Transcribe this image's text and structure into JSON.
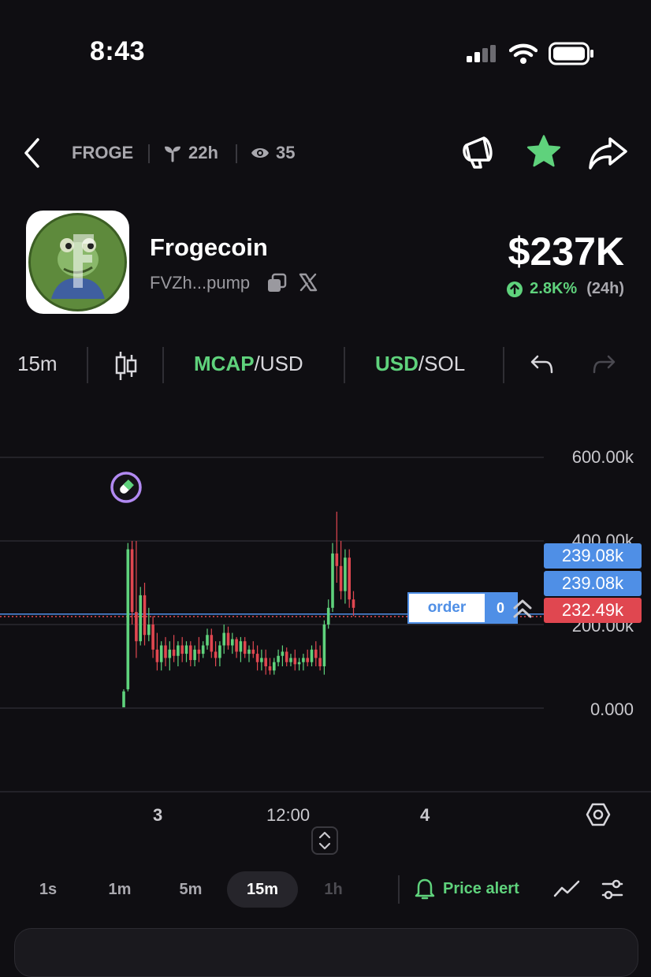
{
  "status_bar": {
    "time": "8:43"
  },
  "header": {
    "ticker": "FROGE",
    "age": "22h",
    "watchers": "35"
  },
  "token": {
    "name": "Frogecoin",
    "address": "FVZh...pump",
    "market_cap": "$237K",
    "change_pct": "2.8K%",
    "change_period": "(24h)"
  },
  "toolbar": {
    "interval": "15m",
    "mcap_highlight": "MCAP",
    "mcap_suffix": "/USD",
    "usd_highlight": "USD",
    "usd_suffix": "/SOL"
  },
  "chart_data": {
    "type": "candlestick",
    "y_ticks": [
      "600.00k",
      "400.00k",
      "200.00k",
      "0.000"
    ],
    "ylim": [
      0,
      600000
    ],
    "x_ticks": [
      "3",
      "12:00",
      "4"
    ],
    "price_labels": [
      "239.08k",
      "239.08k",
      "232.49k"
    ],
    "order_label": "order",
    "order_count": "0",
    "candles": [
      [
        2,
        45,
        2,
        40
      ],
      [
        45,
        395,
        40,
        380
      ],
      [
        380,
        400,
        200,
        230
      ],
      [
        230,
        400,
        120,
        160
      ],
      [
        160,
        290,
        150,
        270
      ],
      [
        270,
        300,
        150,
        175
      ],
      [
        175,
        240,
        160,
        200
      ],
      [
        200,
        220,
        120,
        140
      ],
      [
        140,
        180,
        90,
        110
      ],
      [
        110,
        160,
        90,
        150
      ],
      [
        150,
        170,
        100,
        120
      ],
      [
        120,
        160,
        90,
        140
      ],
      [
        140,
        175,
        110,
        125
      ],
      [
        125,
        160,
        100,
        150
      ],
      [
        150,
        170,
        110,
        130
      ],
      [
        130,
        160,
        110,
        150
      ],
      [
        150,
        160,
        100,
        115
      ],
      [
        115,
        150,
        100,
        140
      ],
      [
        140,
        170,
        110,
        130
      ],
      [
        130,
        160,
        120,
        150
      ],
      [
        150,
        190,
        140,
        175
      ],
      [
        175,
        190,
        120,
        135
      ],
      [
        135,
        160,
        100,
        120
      ],
      [
        120,
        160,
        100,
        150
      ],
      [
        150,
        200,
        130,
        180
      ],
      [
        180,
        195,
        140,
        150
      ],
      [
        150,
        180,
        130,
        165
      ],
      [
        165,
        170,
        120,
        135
      ],
      [
        135,
        170,
        110,
        160
      ],
      [
        160,
        170,
        120,
        130
      ],
      [
        130,
        150,
        110,
        140
      ],
      [
        140,
        160,
        120,
        130
      ],
      [
        130,
        150,
        90,
        110
      ],
      [
        110,
        140,
        90,
        120
      ],
      [
        120,
        140,
        80,
        100
      ],
      [
        100,
        120,
        80,
        90
      ],
      [
        90,
        120,
        80,
        110
      ],
      [
        110,
        140,
        100,
        125
      ],
      [
        125,
        150,
        100,
        135
      ],
      [
        135,
        145,
        100,
        110
      ],
      [
        110,
        130,
        100,
        120
      ],
      [
        120,
        140,
        90,
        105
      ],
      [
        105,
        120,
        90,
        110
      ],
      [
        110,
        130,
        90,
        120
      ],
      [
        120,
        140,
        100,
        110
      ],
      [
        110,
        150,
        100,
        140
      ],
      [
        140,
        160,
        100,
        120
      ],
      [
        120,
        150,
        90,
        100
      ],
      [
        100,
        210,
        80,
        200
      ],
      [
        200,
        260,
        190,
        240
      ],
      [
        240,
        395,
        230,
        370
      ],
      [
        370,
        470,
        300,
        340
      ],
      [
        340,
        400,
        260,
        280
      ],
      [
        280,
        380,
        250,
        360
      ],
      [
        360,
        380,
        240,
        260
      ],
      [
        260,
        280,
        220,
        240
      ]
    ]
  },
  "bottom_bar": {
    "timeframes": [
      "1s",
      "1m",
      "5m",
      "15m",
      "1h"
    ],
    "selected_timeframe": "15m",
    "price_alert_label": "Price alert"
  },
  "colors": {
    "up": "#5fd27c",
    "down": "#e04750",
    "accent_blue": "#4f8fe6",
    "alert_red": "#e04750"
  }
}
